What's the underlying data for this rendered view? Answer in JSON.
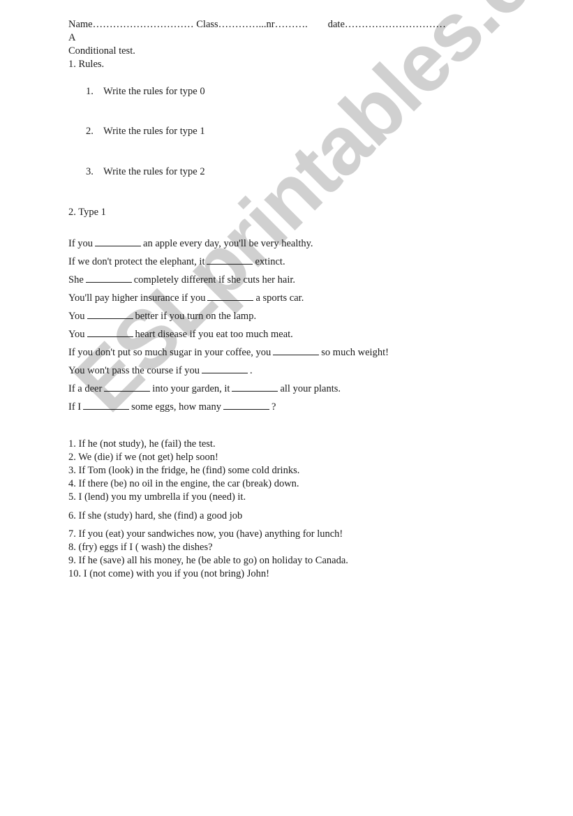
{
  "header": {
    "name_label": "Name………………………… ",
    "class_label": "Class…………...nr……….",
    "date_label": "date…………………………"
  },
  "version": "A",
  "title": "Conditional test.",
  "section1": {
    "heading": "1. Rules.",
    "items": [
      {
        "num": "1.",
        "text": "Write the rules for type 0"
      },
      {
        "num": "2.",
        "text": "Write the rules for type 1"
      },
      {
        "num": "3.",
        "text": "Write the rules for type 2"
      }
    ]
  },
  "section2": {
    "heading": "2. Type 1",
    "sentences": [
      [
        "If you",
        "an apple every day, you'll be very healthy."
      ],
      [
        "If we don't protect the elephant, it",
        "extinct."
      ],
      [
        "She",
        "completely different if she cuts her hair."
      ],
      [
        "You'll pay higher insurance if you",
        "a sports car."
      ],
      [
        "You",
        "better if you turn on the lamp."
      ],
      [
        "You",
        "heart disease if you eat too much meat."
      ],
      [
        "If you don't put so much sugar in your coffee, you",
        "so much weight!"
      ],
      [
        "You won't pass the course if you",
        "."
      ],
      [
        "If a deer",
        "into your garden, it",
        "all your plants."
      ],
      [
        "If I",
        "some eggs, how many",
        "?"
      ]
    ]
  },
  "section3": {
    "items": [
      "1. If he (not study), he (fail) the test.",
      "2. We (die) if we (not get) help soon!",
      "3. If Tom (look) in the fridge, he (find) some cold drinks.",
      "4. If there (be) no oil in the engine, the car (break) down.",
      "5. I (lend) you my umbrella if you (need) it.",
      "6. If she (study) hard, she (find) a good job",
      "7. If you (eat) your sandwiches now, you (have) anything for lunch!",
      "8. (fry) eggs if I ( wash) the dishes?",
      "9. If he (save) all his money, he (be able to go) on holiday to Canada.",
      "10. I (not come) with you if you (not bring) John!"
    ]
  },
  "watermark": "ESLprintables.com"
}
